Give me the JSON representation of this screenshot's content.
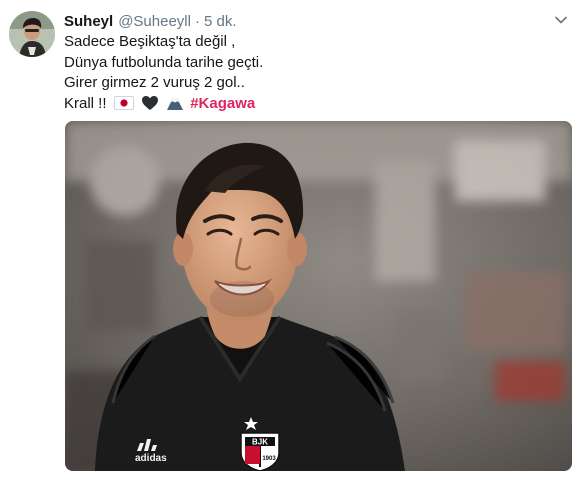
{
  "tweet": {
    "author": {
      "name": "Suheyl",
      "handle": "@Suheeyll",
      "separator": "·",
      "time": "5 dk."
    },
    "text": {
      "line1": "Sadece Beşiktaş'ta değil ,",
      "line2": "Dünya futbolunda tarihe geçti.",
      "line3": "Girer girmez 2 vuruş 2 gol..",
      "line4_prefix": "Krall !!",
      "emojis": [
        "japan-flag",
        "black-heart",
        "mount-fuji"
      ],
      "hashtag": "#Kagawa"
    },
    "media": {
      "kit_brand_mark": "adidas",
      "crest_text": "BJK",
      "crest_year": "1903"
    },
    "colors": {
      "hashtag": "#e0245e",
      "secondary_text": "#657786",
      "primary_text": "#14171a"
    }
  }
}
